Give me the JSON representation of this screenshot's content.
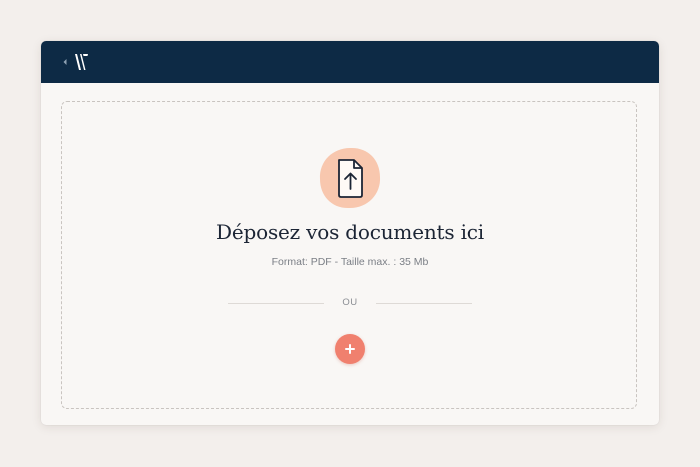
{
  "upload": {
    "title": "Déposez vos documents ici",
    "format_info": "Format: PDF - Taille max. : 35 Mb",
    "separator": "OU"
  },
  "icons": {
    "back": "chevron-left-icon",
    "logo": "brand-logo",
    "upload": "file-upload-icon",
    "add": "plus-icon"
  },
  "colors": {
    "header": "#0d2a45",
    "accent": "#f0806e",
    "icon_circle": "#f8c7ae",
    "background": "#f3efec"
  }
}
